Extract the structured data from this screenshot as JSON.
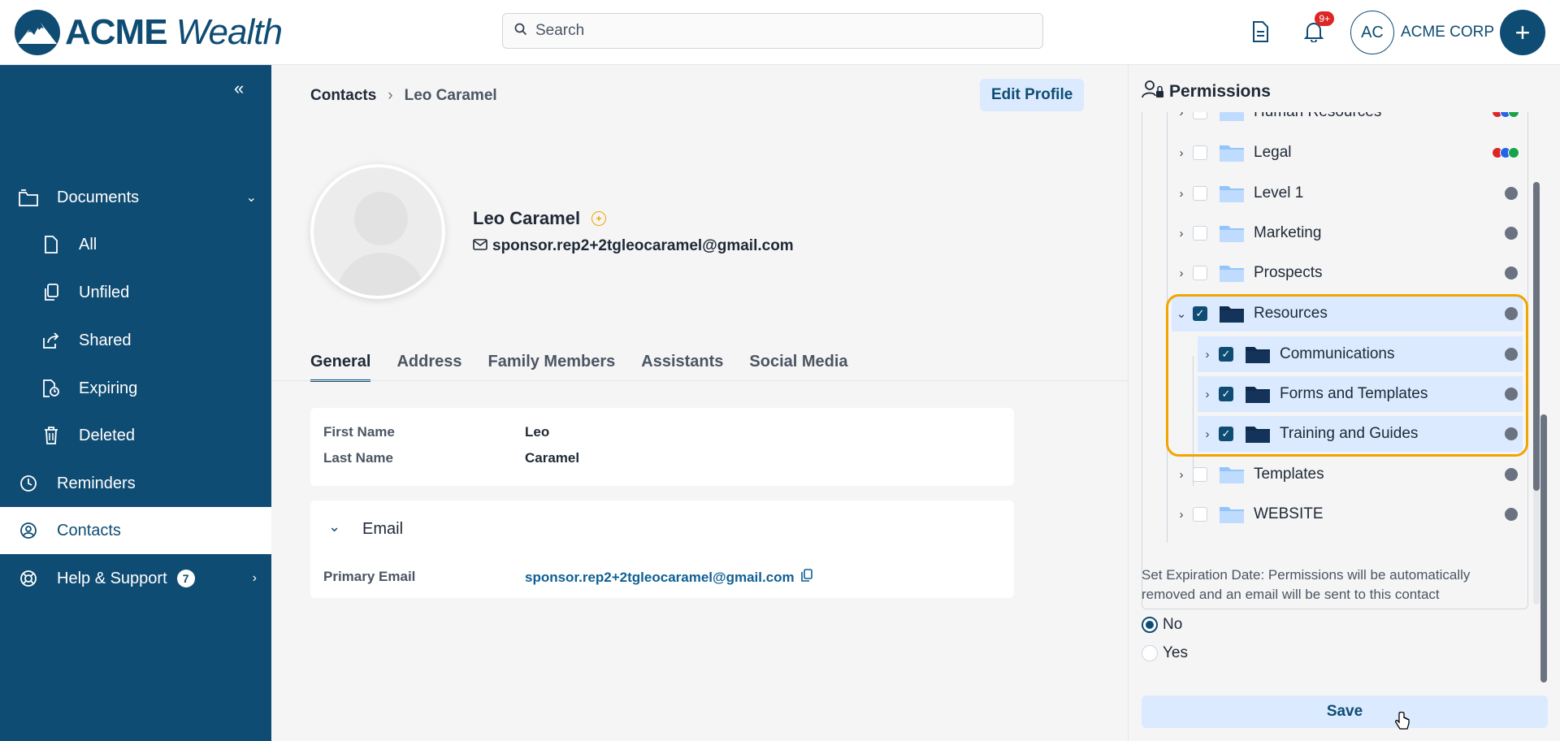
{
  "brand": {
    "name_bold": "ACME",
    "name_italic": "Wealth"
  },
  "search": {
    "placeholder": "Search"
  },
  "header": {
    "notification_count": "9+",
    "avatar_initials": "AC",
    "org_name": "ACME CORP",
    "add_label": "+"
  },
  "sidebar": {
    "items": [
      {
        "label": "Documents",
        "icon": "folder-icon"
      },
      {
        "label": "All",
        "icon": "file-icon"
      },
      {
        "label": "Unfiled",
        "icon": "copy-icon"
      },
      {
        "label": "Shared",
        "icon": "share-icon"
      },
      {
        "label": "Expiring",
        "icon": "file-clock-icon"
      },
      {
        "label": "Deleted",
        "icon": "trash-icon"
      },
      {
        "label": "Reminders",
        "icon": "clock-icon"
      },
      {
        "label": "Contacts",
        "icon": "user-circle-icon"
      },
      {
        "label": "Help & Support",
        "icon": "lifebuoy-icon",
        "badge": "7"
      }
    ]
  },
  "breadcrumb": {
    "root": "Contacts",
    "current": "Leo Caramel"
  },
  "profile": {
    "edit_label": "Edit Profile",
    "name": "Leo Caramel",
    "email": "sponsor.rep2+2tgleocaramel@gmail.com"
  },
  "tabs": [
    "General",
    "Address",
    "Family Members",
    "Assistants",
    "Social Media"
  ],
  "general": {
    "first_name_label": "First Name",
    "first_name": "Leo",
    "last_name_label": "Last Name",
    "last_name": "Caramel"
  },
  "email_section": {
    "title": "Email",
    "primary_label": "Primary Email",
    "primary_value": "sponsor.rep2+2tgleocaramel@gmail.com"
  },
  "permissions": {
    "title": "Permissions",
    "folders": [
      {
        "label": "Human Resources",
        "checked": false
      },
      {
        "label": "Legal",
        "checked": false
      },
      {
        "label": "Level 1",
        "checked": false
      },
      {
        "label": "Marketing",
        "checked": false
      },
      {
        "label": "Prospects",
        "checked": false
      },
      {
        "label": "Resources",
        "checked": true
      },
      {
        "label": "Communications",
        "checked": true
      },
      {
        "label": "Forms and Templates",
        "checked": true
      },
      {
        "label": "Training and Guides",
        "checked": true
      },
      {
        "label": "Templates",
        "checked": false
      },
      {
        "label": "WEBSITE",
        "checked": false
      }
    ],
    "expiration_text": "Set Expiration Date: Permissions will be automatically removed and an email will be sent to this contact",
    "option_no": "No",
    "option_yes": "Yes",
    "save_label": "Save"
  },
  "colors": {
    "primary": "#0f4c73",
    "highlight": "#f0a500",
    "badge_red": "#dc2626"
  }
}
